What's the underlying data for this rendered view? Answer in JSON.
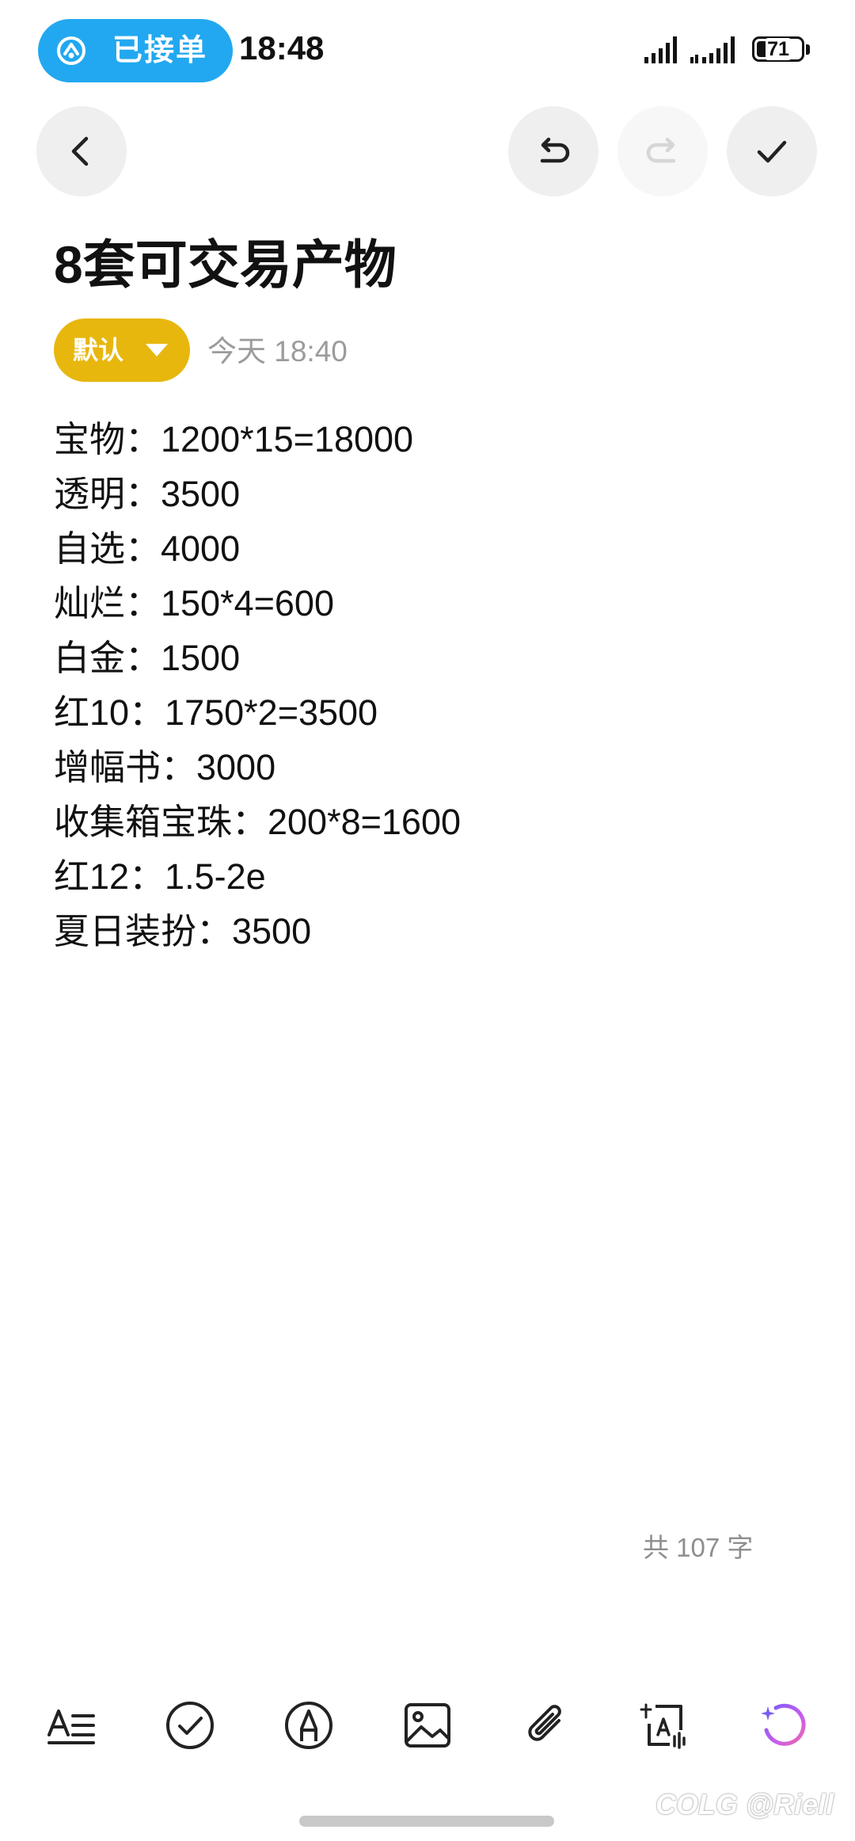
{
  "status_bar": {
    "pill_text": "已接单",
    "pill_icon": "delivery-scooter-icon",
    "time": "18:48",
    "battery_level": "71",
    "battery_fraction": 0.71,
    "pill_color": "#22a8f0"
  },
  "toolbar": {
    "back_icon": "chevron-left-icon",
    "undo_icon": "undo-icon",
    "redo_icon": "redo-icon",
    "done_icon": "checkmark-icon"
  },
  "note": {
    "title": "8套可交易产物",
    "category": "默认",
    "category_color": "#e7b70e",
    "timestamp": "今天 18:40",
    "lines": [
      "宝物：1200*15=18000",
      "透明：3500",
      "自选：4000",
      "灿烂：150*4=600",
      "白金：1500",
      "红10：1750*2=3500",
      "增幅书：3000",
      "收集箱宝珠：200*8=1600",
      "红12：1.5-2e",
      "夏日装扮：3500"
    ],
    "word_count": "共 107 字"
  },
  "bottom_tools": [
    {
      "name": "text-format",
      "icon": "text-format-icon"
    },
    {
      "name": "checklist",
      "icon": "checkbox-circle-icon"
    },
    {
      "name": "handwriting",
      "icon": "pen-nib-icon"
    },
    {
      "name": "insert-image",
      "icon": "image-icon"
    },
    {
      "name": "attachment",
      "icon": "paperclip-icon"
    },
    {
      "name": "text-recognition",
      "icon": "scan-text-icon"
    },
    {
      "name": "ai-assistant",
      "icon": "ai-sparkle-icon"
    }
  ],
  "watermark": "COLG @Riell"
}
